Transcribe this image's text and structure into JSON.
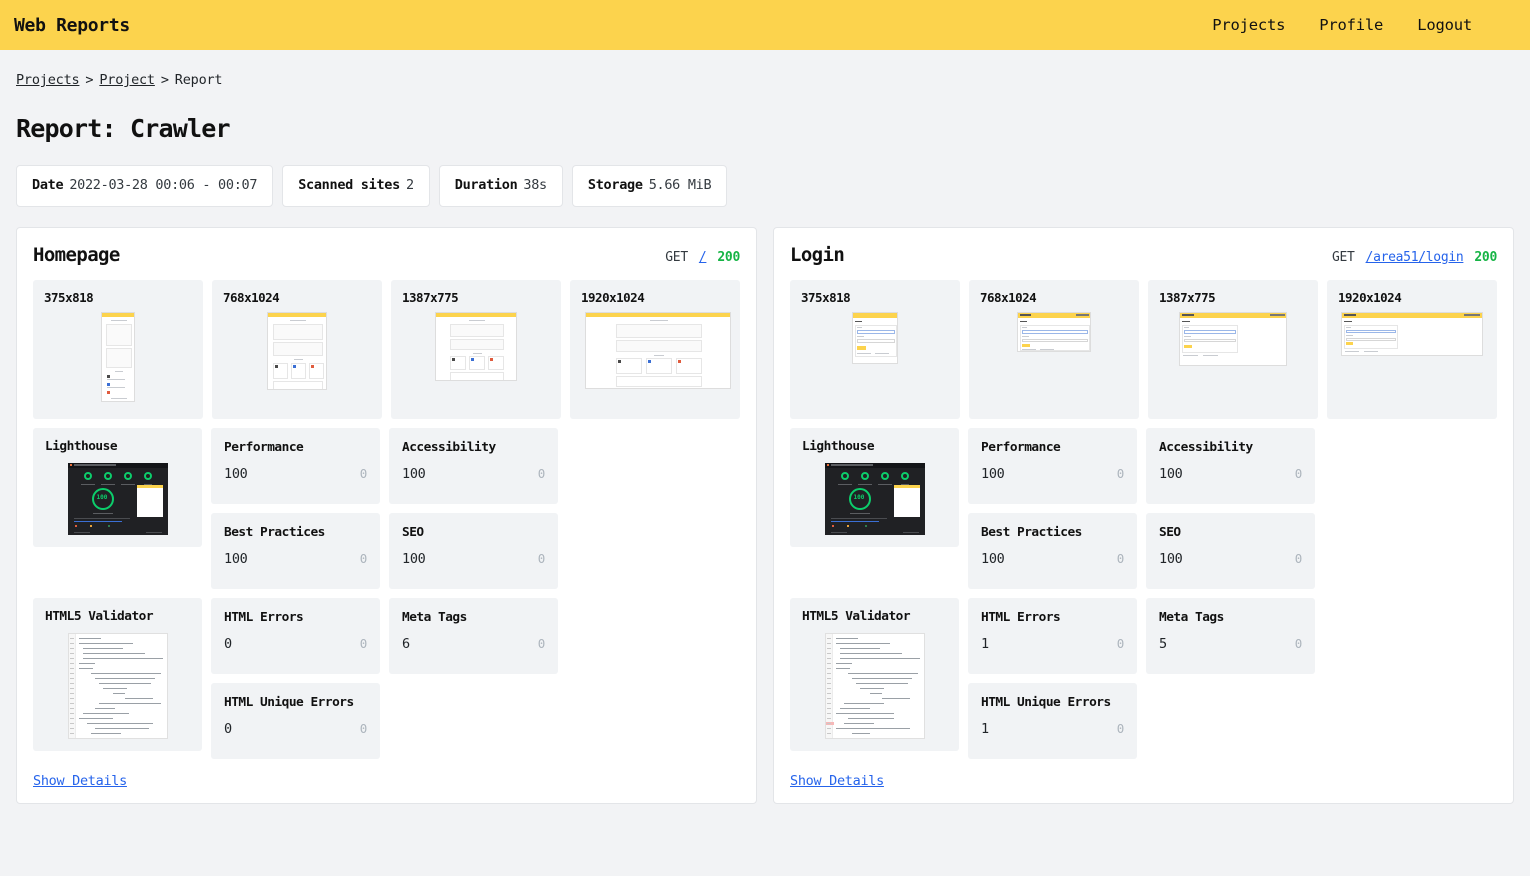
{
  "navbar": {
    "brand": "Web Reports",
    "links": [
      {
        "label": "Projects"
      },
      {
        "label": "Profile"
      },
      {
        "label": "Logout"
      }
    ]
  },
  "breadcrumb": {
    "items": [
      {
        "label": "Projects",
        "link": true
      },
      {
        "label": "Project",
        "link": true
      },
      {
        "label": "Report",
        "link": false
      }
    ],
    "separator": ">"
  },
  "page_title": "Report: Crawler",
  "summary": [
    {
      "key": "Date",
      "value": "2022-03-28 00:06 - 00:07"
    },
    {
      "key": "Scanned sites",
      "value": "2"
    },
    {
      "key": "Duration",
      "value": "38s"
    },
    {
      "key": "Storage",
      "value": "5.66 MiB"
    }
  ],
  "colors": {
    "brand_yellow": "#fcd34d",
    "link_blue": "#2563eb",
    "status_green": "#16b445",
    "page_bg": "#f2f3f5",
    "card_bg": "#f1f3f5"
  },
  "panels": [
    {
      "title": "Homepage",
      "request": {
        "method": "GET",
        "url": "/",
        "status": "200"
      },
      "screenshots": [
        {
          "label": "375x818",
          "kind": "home-mobile"
        },
        {
          "label": "768x1024",
          "kind": "home-tablet"
        },
        {
          "label": "1387x775",
          "kind": "home-desktop"
        },
        {
          "label": "1920x1024",
          "kind": "home-wide"
        }
      ],
      "lighthouse": {
        "title": "Lighthouse",
        "metrics": [
          {
            "title": "Performance",
            "value": "100",
            "delta": "0"
          },
          {
            "title": "Accessibility",
            "value": "100",
            "delta": "0"
          },
          {
            "title": "Best Practices",
            "value": "100",
            "delta": "0"
          },
          {
            "title": "SEO",
            "value": "100",
            "delta": "0"
          }
        ]
      },
      "validator": {
        "title": "HTML5 Validator",
        "metrics": [
          {
            "title": "HTML Errors",
            "value": "0",
            "delta": "0"
          },
          {
            "title": "Meta Tags",
            "value": "6",
            "delta": "0"
          },
          {
            "title": "HTML Unique Errors",
            "value": "0",
            "delta": "0"
          }
        ]
      },
      "show_details": "Show Details"
    },
    {
      "title": "Login",
      "request": {
        "method": "GET",
        "url": "/area51/login",
        "status": "200"
      },
      "screenshots": [
        {
          "label": "375x818",
          "kind": "login-mobile"
        },
        {
          "label": "768x1024",
          "kind": "login-tablet"
        },
        {
          "label": "1387x775",
          "kind": "login-desktop"
        },
        {
          "label": "1920x1024",
          "kind": "login-wide"
        }
      ],
      "lighthouse": {
        "title": "Lighthouse",
        "metrics": [
          {
            "title": "Performance",
            "value": "100",
            "delta": "0"
          },
          {
            "title": "Accessibility",
            "value": "100",
            "delta": "0"
          },
          {
            "title": "Best Practices",
            "value": "100",
            "delta": "0"
          },
          {
            "title": "SEO",
            "value": "100",
            "delta": "0"
          }
        ]
      },
      "validator": {
        "title": "HTML5 Validator",
        "metrics": [
          {
            "title": "HTML Errors",
            "value": "1",
            "delta": "0"
          },
          {
            "title": "Meta Tags",
            "value": "5",
            "delta": "0"
          },
          {
            "title": "HTML Unique Errors",
            "value": "1",
            "delta": "0"
          }
        ]
      },
      "show_details": "Show Details"
    }
  ]
}
